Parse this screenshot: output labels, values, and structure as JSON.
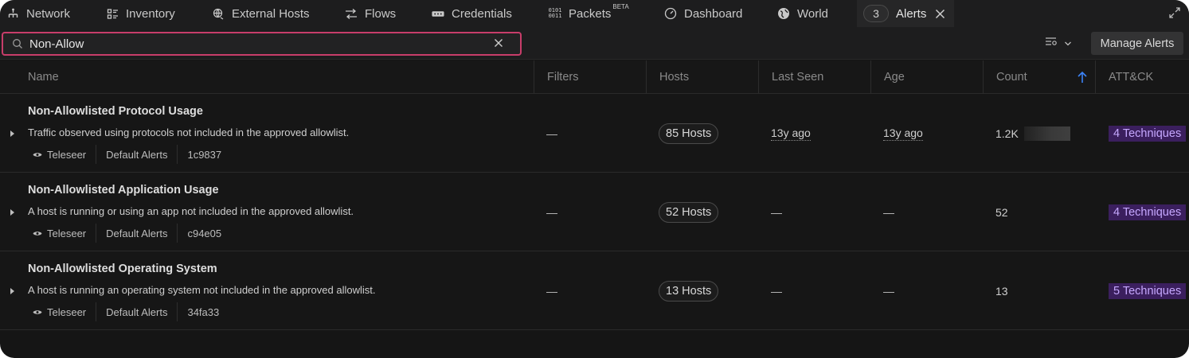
{
  "tabs": [
    {
      "label": "Network",
      "icon": "network-icon"
    },
    {
      "label": "Inventory",
      "icon": "inventory-icon"
    },
    {
      "label": "External Hosts",
      "icon": "external-hosts-icon"
    },
    {
      "label": "Flows",
      "icon": "flows-icon"
    },
    {
      "label": "Credentials",
      "icon": "credentials-icon"
    },
    {
      "label": "Packets",
      "icon": "packets-icon",
      "badge": "BETA"
    },
    {
      "label": "Dashboard",
      "icon": "dashboard-icon"
    },
    {
      "label": "World",
      "icon": "globe-icon"
    },
    {
      "label": "Alerts",
      "count": "3",
      "icon": "close-icon",
      "active": true
    }
  ],
  "search": {
    "value": "Non-Allow",
    "icon": "search-icon"
  },
  "toolbar": {
    "manage_label": "Manage Alerts",
    "view_icon": "view-options-icon"
  },
  "columns": [
    "Name",
    "Filters",
    "Hosts",
    "Last Seen",
    "Age",
    "Count",
    "ATT&CK"
  ],
  "rows": [
    {
      "name": "Non-Allowlisted Protocol Usage",
      "description": "Traffic observed using protocols not included in the approved allowlist.",
      "source": "Teleseer",
      "group": "Default Alerts",
      "id": "1c9837",
      "filters": "—",
      "hosts": "85 Hosts",
      "last_seen": "13y ago",
      "age": "13y ago",
      "count": "1.2K",
      "attack": "4 Techniques"
    },
    {
      "name": "Non-Allowlisted Application Usage",
      "description": "A host is running or using an app not included in the approved allowlist.",
      "source": "Teleseer",
      "group": "Default Alerts",
      "id": "c94e05",
      "filters": "—",
      "hosts": "52 Hosts",
      "last_seen": "—",
      "age": "—",
      "count": "52",
      "attack": "4 Techniques"
    },
    {
      "name": "Non-Allowlisted Operating System",
      "description": "A host is running an operating system not included in the approved allowlist.",
      "source": "Teleseer",
      "group": "Default Alerts",
      "id": "34fa33",
      "filters": "—",
      "hosts": "13 Hosts",
      "last_seen": "—",
      "age": "—",
      "count": "13",
      "attack": "5 Techniques"
    }
  ],
  "colors": {
    "accent": "#c83d6a",
    "technique_bg": "#3b1f5e",
    "technique_text": "#c6a8ff",
    "sort_arrow": "#3b82f6"
  }
}
